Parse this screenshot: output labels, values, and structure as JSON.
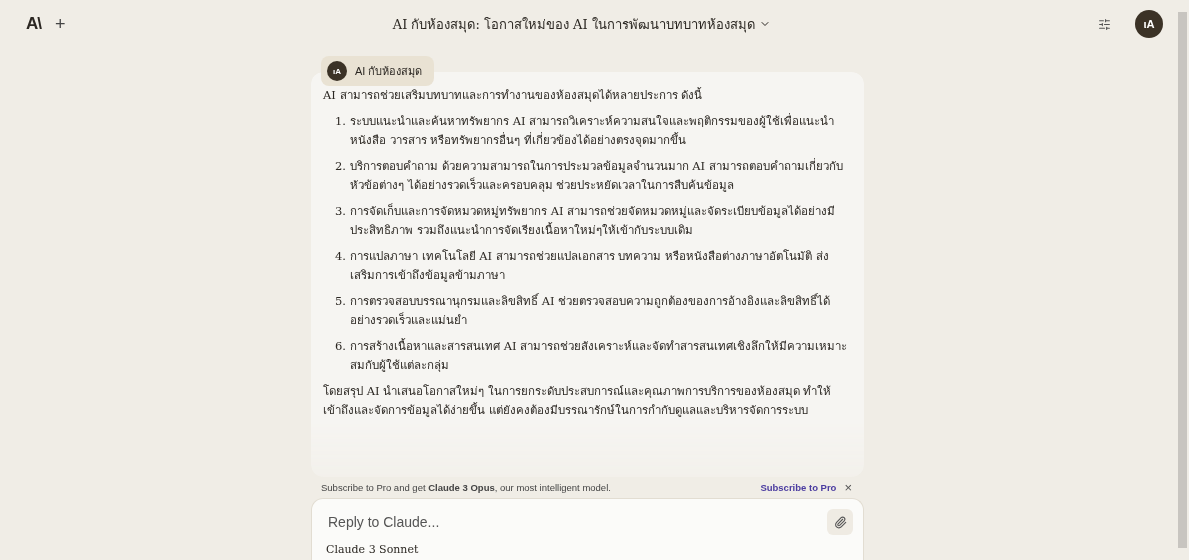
{
  "header": {
    "logo": "A\\",
    "new_chat": "+",
    "title": "AI กับห้องสมุด: โอกาสใหม่ของ AI ในการพัฒนาบทบาทห้องสมุด",
    "avatar": "ιA"
  },
  "project_chip": {
    "avatar": "ιA",
    "label": "AI กับห้องสมุด"
  },
  "response": {
    "intro": "AI สามารถช่วยเสริมบทบาทและการทำงานของห้องสมุดได้หลายประการ ดังนี้",
    "items": [
      {
        "number": "1.",
        "text": "ระบบแนะนำและค้นหาทรัพยากร AI สามารถวิเคราะห์ความสนใจและพฤติกรรมของผู้ใช้เพื่อแนะนำหนังสือ วารสาร หรือทรัพยากรอื่นๆ ที่เกี่ยวข้องได้อย่างตรงจุดมากขึ้น"
      },
      {
        "number": "2.",
        "text": "บริการตอบคำถาม ด้วยความสามารถในการประมวลข้อมูลจำนวนมาก AI สามารถตอบคำถามเกี่ยวกับหัวข้อต่างๆ ได้อย่างรวดเร็วและครอบคลุม ช่วยประหยัดเวลาในการสืบค้นข้อมูล"
      },
      {
        "number": "3.",
        "text": "การจัดเก็บและการจัดหมวดหมู่ทรัพยากร AI สามารถช่วยจัดหมวดหมู่และจัดระเบียบข้อมูลได้อย่างมีประสิทธิภาพ รวมถึงแนะนำการจัดเรียงเนื้อหาใหม่ๆให้เข้ากับระบบเดิม"
      },
      {
        "number": "4.",
        "text": "การแปลภาษา เทคโนโลยี AI สามารถช่วยแปลเอกสาร บทความ หรือหนังสือต่างภาษาอัตโนมัติ ส่งเสริมการเข้าถึงข้อมูลข้ามภาษา"
      },
      {
        "number": "5.",
        "text": "การตรวจสอบบรรณานุกรมและลิขสิทธิ์ AI ช่วยตรวจสอบความถูกต้องของการอ้างอิงและลิขสิทธิ์ได้อย่างรวดเร็วและแม่นยำ"
      },
      {
        "number": "6.",
        "text": "การสร้างเนื้อหาและสารสนเทศ AI สามารถช่วยสังเคราะห์และจัดทำสารสนเทศเชิงลึกให้มีความเหมาะสมกับผู้ใช้แต่ละกลุ่ม"
      }
    ],
    "summary": "โดยสรุป AI นำเสนอโอกาสใหม่ๆ ในการยกระดับประสบการณ์และคุณภาพการบริการของห้องสมุด ทำให้เข้าถึงและจัดการข้อมูลได้ง่ายขึ้น แต่ยังคงต้องมีบรรณารักษ์ในการกำกับดูแลและบริหารจัดการระบบ"
  },
  "banner": {
    "text": "Subscribe to Pro and get **Claude 3 Opus**, our most intelligent model.",
    "link": "Subscribe to Pro",
    "close": "×"
  },
  "composer": {
    "placeholder": "Reply to Claude...",
    "model": "Claude 3 Sonnet"
  }
}
